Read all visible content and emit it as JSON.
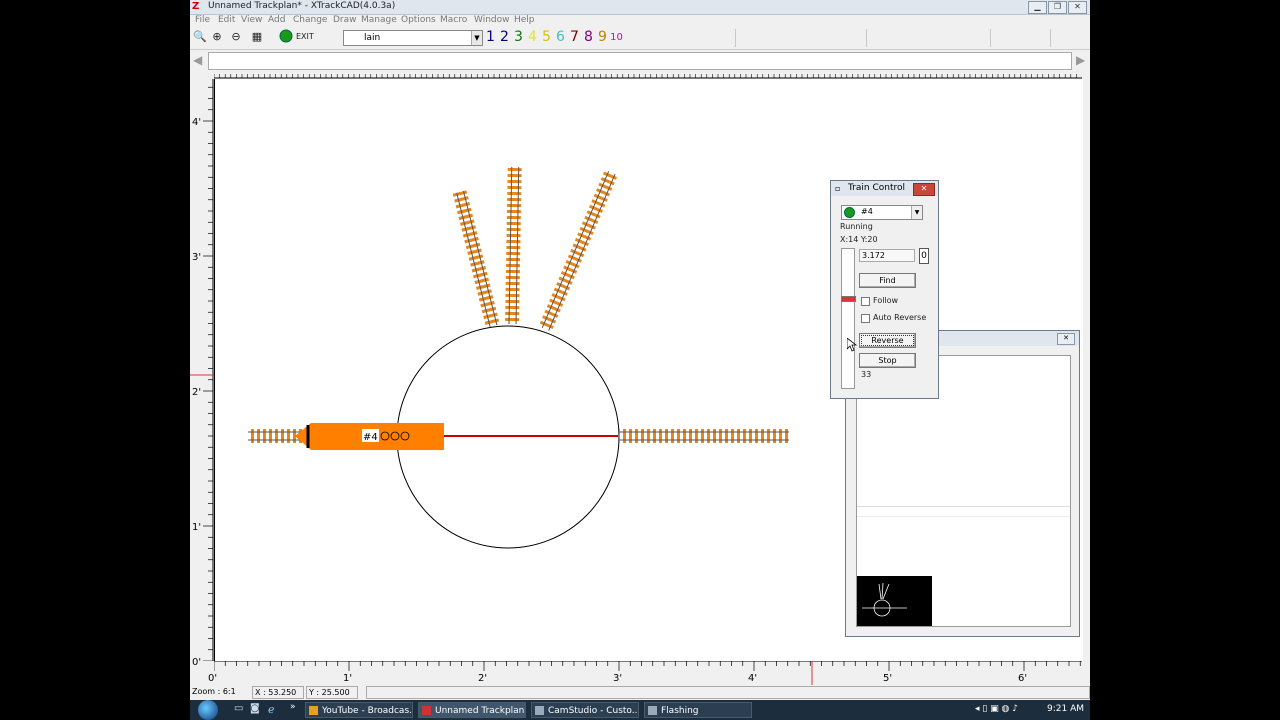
{
  "window": {
    "title": "Unnamed Trackplan* - XTrackCAD(4.0.3a)",
    "app_icon": "xtrackcad-icon"
  },
  "menu": [
    "File",
    "Edit",
    "View",
    "Add",
    "Change",
    "Draw",
    "Manage",
    "Options",
    "Macro",
    "Window",
    "Help"
  ],
  "toolbar": {
    "buttons": [
      "zoom-icon",
      "zoom-in-icon",
      "zoom-out-icon",
      "grid-icon",
      "run-icon",
      "exit-icon"
    ],
    "exit_label": "EXIT",
    "layer_value": "lain",
    "layers": [
      {
        "label": "1",
        "color": "#000080"
      },
      {
        "label": "2",
        "color": "#000080"
      },
      {
        "label": "3",
        "color": "#008000"
      },
      {
        "label": "4",
        "color": "#e0e040"
      },
      {
        "label": "5",
        "color": "#e0c000"
      },
      {
        "label": "6",
        "color": "#40c0c0"
      },
      {
        "label": "7",
        "color": "#800000"
      },
      {
        "label": "8",
        "color": "#800080"
      },
      {
        "label": "9",
        "color": "#c08000"
      },
      {
        "label": "10",
        "color": "#d000d0"
      }
    ]
  },
  "rulers": {
    "vertical": [
      "4'",
      "3'",
      "2'",
      "1'",
      "0'"
    ],
    "horizontal": [
      "0'",
      "1'",
      "2'",
      "3'",
      "4'",
      "5'",
      "6'"
    ]
  },
  "locomotive": {
    "label": "#4",
    "color": "#ff8000"
  },
  "train_control": {
    "title": "Train Control",
    "train": "#4",
    "status": "Running",
    "position": "X:14 Y:20",
    "speed": "3.172",
    "speed_unit": "0",
    "find": "Find",
    "follow": "Follow",
    "auto_reverse": "Auto Reverse",
    "reverse": "Reverse",
    "stop": "Stop",
    "throttle": "33"
  },
  "status": {
    "zoom": "Zoom : 6:1",
    "x": "X : 53.250",
    "y": "Y : 25.500"
  },
  "taskbar": {
    "items": [
      {
        "label": "YouTube - Broadcas...",
        "active": false
      },
      {
        "label": "Unnamed Trackplan...",
        "active": true
      },
      {
        "label": "CamStudio - Custo...",
        "active": false
      },
      {
        "label": "Flashing",
        "active": false
      }
    ],
    "time": "9:21 AM"
  }
}
